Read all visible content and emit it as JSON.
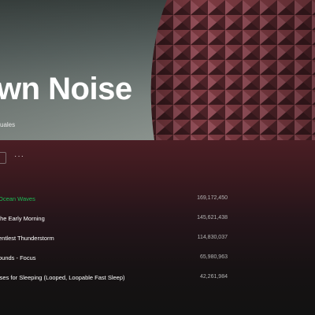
{
  "hero": {
    "title": "wn Noise",
    "subtitle": "uales"
  },
  "actions": {
    "more_label": "···"
  },
  "tracks": [
    {
      "title": "Ocean Waves",
      "plays": "169,172,450",
      "active": true
    },
    {
      "title": "the Early Morning",
      "plays": "145,621,438",
      "active": false
    },
    {
      "title": "entlest Thunderstorm",
      "plays": "114,830,037",
      "active": false
    },
    {
      "title": "ounds - Focus",
      "plays": "65,980,963",
      "active": false
    },
    {
      "title": "ises for Sleeping (Looped, Loopable Fast Sleep)",
      "plays": "42,261,984",
      "active": false
    }
  ],
  "colors": {
    "accent": "#1db954",
    "background": "#121212",
    "header_band": "#4a1e24"
  }
}
